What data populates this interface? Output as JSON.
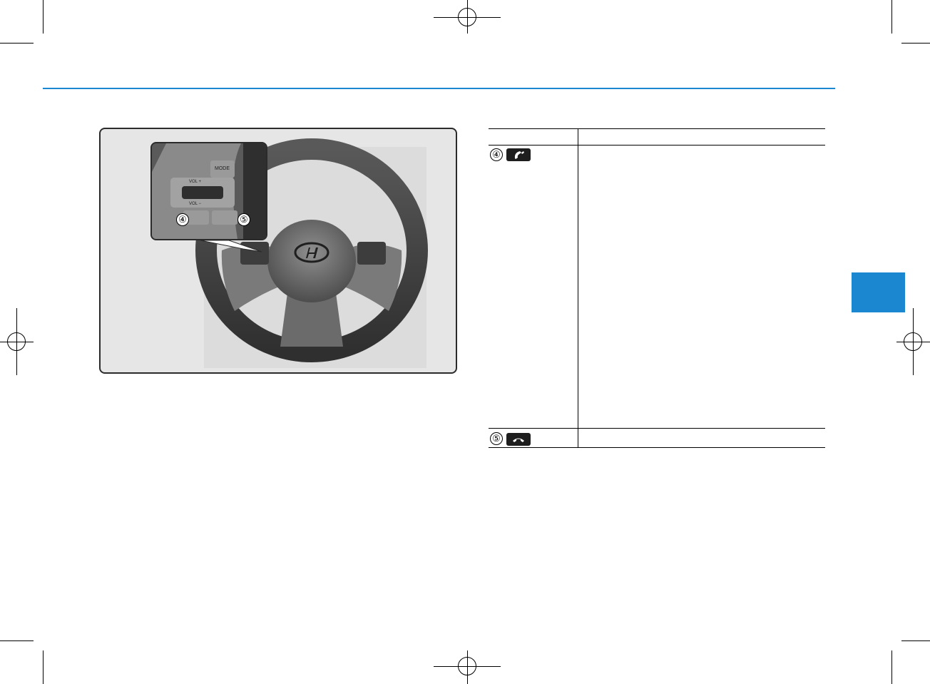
{
  "colors": {
    "accent": "#1b87d0",
    "frame_bg": "#e6e6e6",
    "frame_border": "#2b2b2b",
    "icon_bg": "#1e1e1e"
  },
  "figure": {
    "callouts": [
      "④",
      "⑤"
    ],
    "inset_labels": {
      "mode": "MODE",
      "vol_up": "VOL +",
      "vol_down": "VOL −"
    },
    "icons": [
      "call-answer-icon",
      "call-end-icon",
      "hyundai-logo",
      "steering-wheel"
    ]
  },
  "table": {
    "rows": [
      {
        "callout": "④",
        "icon": "call-answer-icon"
      },
      {
        "callout": "⑤",
        "icon": "call-end-icon"
      }
    ]
  }
}
